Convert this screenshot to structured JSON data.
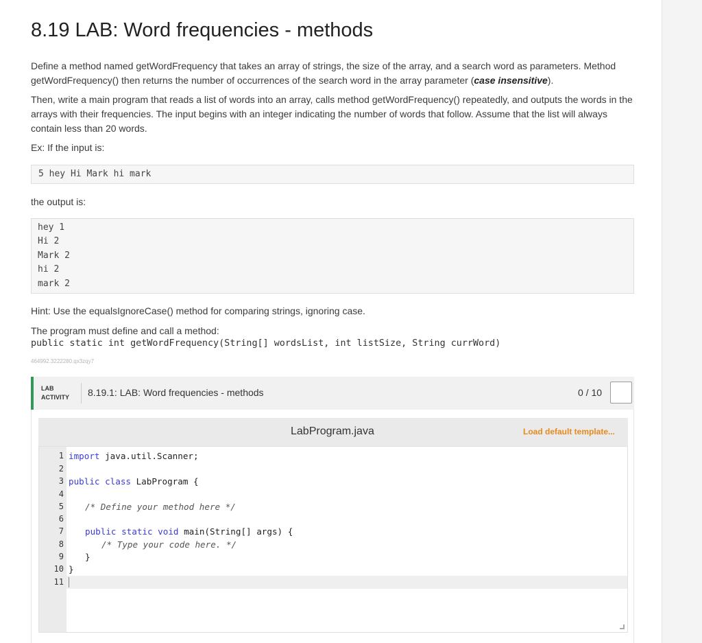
{
  "header": {
    "title": "8.19 LAB: Word frequencies - methods"
  },
  "description": {
    "p1_part1": "Define a method named getWordFrequency that takes an array of strings, the size of the array, and a search word as parameters. Method getWordFrequency() then returns the number of occurrences of the search word in the array parameter (",
    "p1_bold": "case insensitive",
    "p1_part2": ").",
    "p2": "Then, write a main program that reads a list of words into an array, calls method getWordFrequency() repeatedly, and outputs the words in the arrays with their frequencies. The input begins with an integer indicating the number of words that follow. Assume that the list will always contain less than 20 words.",
    "example_intro": "Ex: If the input is:",
    "example_input": "5 hey Hi Mark hi mark",
    "output_intro": "the output is:",
    "example_output": [
      "hey 1",
      "Hi 2",
      "Mark 2",
      "hi 2",
      "mark 2"
    ],
    "hint": "Hint: Use the equalsIgnoreCase() method for comparing strings, ignoring case.",
    "must_define": "The program must define and call a method:",
    "signature": "public static int getWordFrequency(String[] wordsList, int listSize, String currWord)",
    "activity_id": "464992.3222280.qx3zqy7"
  },
  "lab_activity": {
    "label_line1": "LAB",
    "label_line2": "ACTIVITY",
    "title": "8.19.1: LAB: Word frequencies - methods",
    "score": "0 / 10"
  },
  "editor": {
    "file_name": "LabProgram.java",
    "load_template_label": "Load default template...",
    "line_numbers": [
      "1",
      "2",
      "3",
      "4",
      "5",
      "6",
      "7",
      "8",
      "9",
      "10",
      "11"
    ],
    "code": {
      "l1_kw": "import",
      "l1_rest": " java.util.Scanner;",
      "l3_kw": "public class",
      "l3_rest": " LabProgram {",
      "l5": "/* Define your method here */",
      "l7_kw": "public static void",
      "l7_rest": " main(String[] args) {",
      "l8": "/* Type your code here. */",
      "l9": "}",
      "l10": "}"
    }
  }
}
